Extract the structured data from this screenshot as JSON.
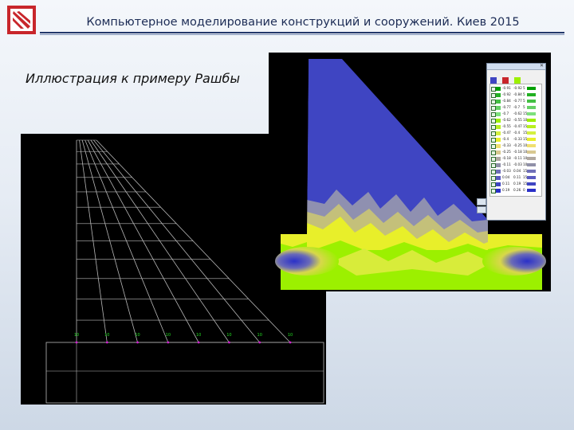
{
  "header": {
    "title": "Компьютерное моделирование конструкций и сооружений. Киев 2015"
  },
  "slide": {
    "subtitle": "Иллюстрация к примеру Рашбы"
  },
  "colors": {
    "navy": "#1c2c55",
    "logo_red": "#c8262b",
    "stress_blue": "#3f45c2",
    "stress_green": "#9cf000",
    "stress_yellow": "#e8ef2a"
  },
  "mesh_figure": {
    "node_labels": [
      "10",
      "10",
      "10",
      "10",
      "10",
      "10",
      "10",
      "10"
    ]
  },
  "legend": {
    "rows": [
      {
        "color": "#00a000",
        "v1": "-0.91",
        "v2": "-0.92",
        "flag": "5"
      },
      {
        "color": "#22b022",
        "v1": "-0.92",
        "v2": "-0.84",
        "flag": "5"
      },
      {
        "color": "#44c044",
        "v1": "-0.84",
        "v2": "-0.77",
        "flag": "5"
      },
      {
        "color": "#66d066",
        "v1": "-0.77",
        "v2": "-0.7",
        "flag": "5"
      },
      {
        "color": "#7de07d",
        "v1": "-0.7",
        "v2": "-0.62",
        "flag": "15"
      },
      {
        "color": "#9cf000",
        "v1": "-0.62",
        "v2": "-0.55",
        "flag": "10"
      },
      {
        "color": "#b8f020",
        "v1": "-0.55",
        "v2": "-0.47",
        "flag": "15"
      },
      {
        "color": "#d4f040",
        "v1": "-0.47",
        "v2": "-0.4",
        "flag": "15"
      },
      {
        "color": "#e8ef2a",
        "v1": "-0.4",
        "v2": "-0.33",
        "flag": "15"
      },
      {
        "color": "#f0e070",
        "v1": "-0.33",
        "v2": "-0.25",
        "flag": "10"
      },
      {
        "color": "#d8c890",
        "v1": "-0.25",
        "v2": "-0.18",
        "flag": "10"
      },
      {
        "color": "#b0a8a0",
        "v1": "-0.18",
        "v2": "-0.11",
        "flag": "10"
      },
      {
        "color": "#9090a8",
        "v1": "-0.11",
        "v2": "-0.03",
        "flag": "10"
      },
      {
        "color": "#7070b8",
        "v1": "-0.03",
        "v2": "0.04",
        "flag": "15"
      },
      {
        "color": "#5a5ac0",
        "v1": "0.04",
        "v2": "0.11",
        "flag": "15"
      },
      {
        "color": "#3f45c2",
        "v1": "0.11",
        "v2": "0.19",
        "flag": "15"
      },
      {
        "color": "#2a30c8",
        "v1": "0.19",
        "v2": "0.26",
        "flag": "0"
      }
    ]
  }
}
